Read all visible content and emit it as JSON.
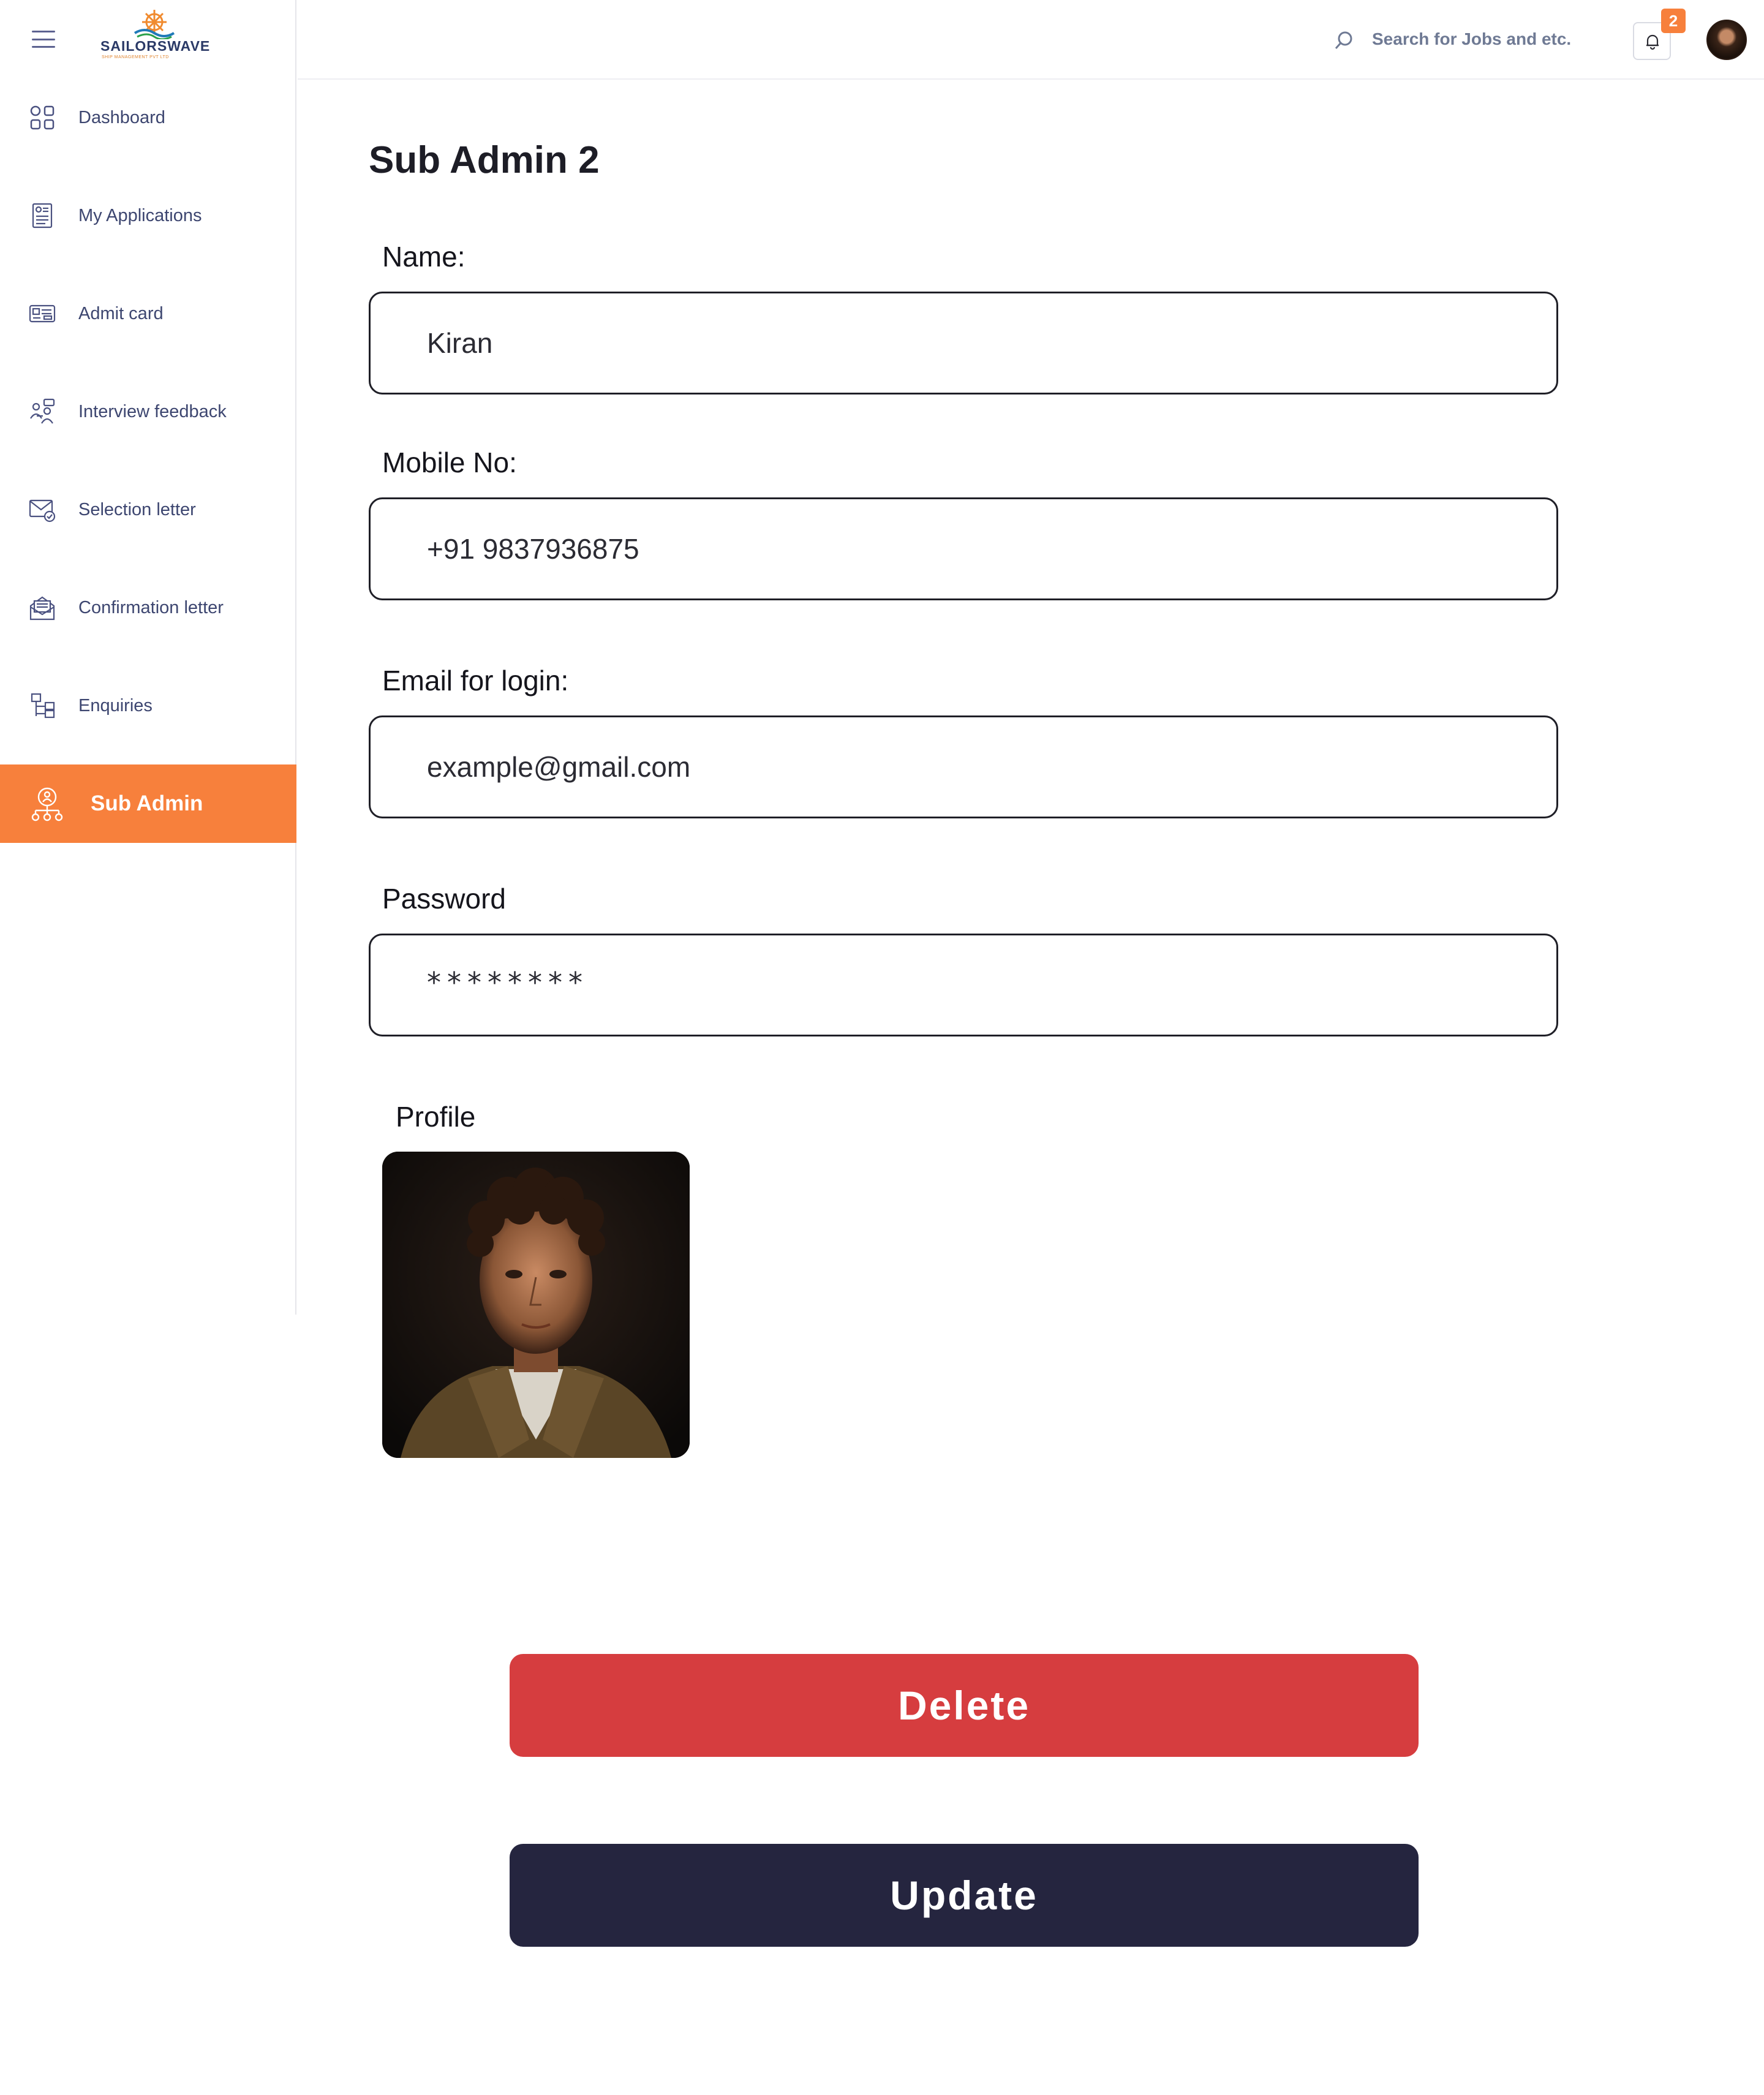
{
  "brand": {
    "name": "SAILORSWAVE",
    "tagline": "SHIP MANAGEMENT PVT LTD"
  },
  "sidebar": {
    "items": [
      {
        "label": "Dashboard",
        "icon": "grid-icon",
        "active": false
      },
      {
        "label": "My Applications",
        "icon": "application-form-icon",
        "active": false
      },
      {
        "label": "Admit card",
        "icon": "id-card-icon",
        "active": false
      },
      {
        "label": "Interview feedback",
        "icon": "interview-icon",
        "active": false
      },
      {
        "label": "Selection letter",
        "icon": "mail-check-icon",
        "active": false
      },
      {
        "label": "Confirmation letter",
        "icon": "open-letter-icon",
        "active": false
      },
      {
        "label": "Enquiries",
        "icon": "enquiry-icon",
        "active": false
      },
      {
        "label": "Sub Admin",
        "icon": "org-chart-icon",
        "active": true
      }
    ]
  },
  "header": {
    "search_placeholder": "Search for Jobs and etc.",
    "notification_count": "2"
  },
  "form": {
    "title": "Sub Admin 2",
    "name_label": "Name:",
    "name_value": "Kiran",
    "mobile_label": "Mobile No:",
    "mobile_value": "+91 9837936875",
    "email_label": "Email for login:",
    "email_value": "example@gmail.com",
    "password_label": "Password",
    "password_value": "********",
    "profile_label": "Profile"
  },
  "actions": {
    "delete_label": "Delete",
    "update_label": "Update"
  },
  "colors": {
    "accent": "#f7803c",
    "danger": "#d63d3f",
    "primary_dark": "#25253f",
    "nav_text": "#3d4670"
  }
}
